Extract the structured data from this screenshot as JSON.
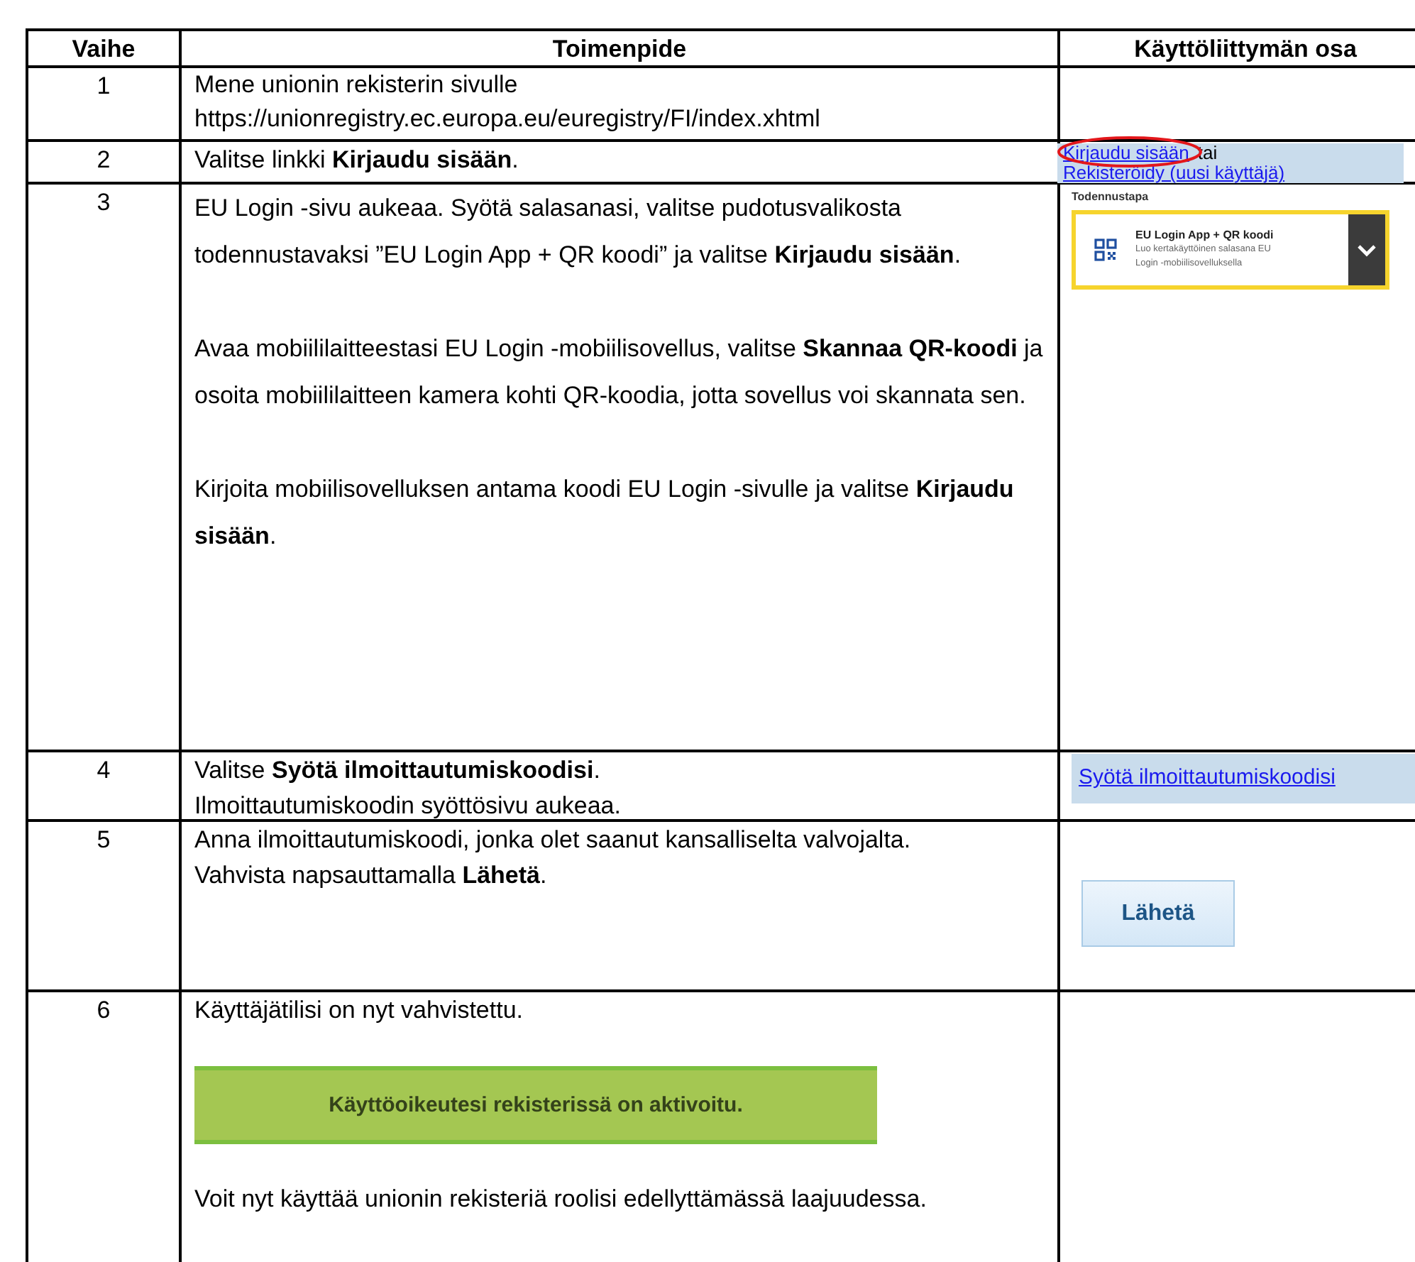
{
  "table": {
    "columns": [
      "Vaihe",
      "Toimenpide",
      "Käyttöliittymän osa"
    ],
    "rows": [
      {
        "step": "1",
        "content": [
          {
            "kind": "text",
            "lines": [
              "Mene unionin rekisterin sivulle https://unionregistry.ec.europa.eu/euregistry/FI/index.xhtml"
            ]
          }
        ]
      },
      {
        "step": "2",
        "content": [
          {
            "kind": "text",
            "lines": [
              "Valitse linkki **Kirjaudu sisään**."
            ]
          }
        ],
        "ui": {
          "kind": "login_links",
          "first_link": "Kirjaudu sisään",
          "joiner": "tai",
          "second_link": "Rekisteröidy (uusi käyttäjä)",
          "circled": true
        }
      },
      {
        "step": "3",
        "content": [
          {
            "kind": "text",
            "lines": [
              "EU Login -sivu aukeaa. Syötä salasanasi, valitse pudotusvalikosta todennustavaksi ”EU Login App + QR koodi” ja valitse **Kirjaudu sisään**."
            ]
          },
          {
            "kind": "text",
            "lines": [
              "Avaa mobiililaitteestasi EU Login -mobiilisovellus, valitse **Skannaa QR-koodi** ja osoita mobiililaitteen kamera kohti QR-koodia, jotta sovellus voi skannata sen."
            ]
          },
          {
            "kind": "text",
            "lines": [
              "Kirjoita mobiilisovelluksen antama koodi EU Login -sivulle ja valitse **Kirjaudu sisään**."
            ]
          }
        ],
        "ui": {
          "kind": "auth_select",
          "label": "Todennustapa",
          "title": "EU Login App + QR koodi",
          "subtitle": "Luo kertakäyttöinen salasana EU Login -mobiilisovelluksella"
        }
      },
      {
        "step": "4",
        "content": [
          {
            "kind": "text",
            "lines": [
              "Valitse **Syötä ilmoittautumiskoodisi**.",
              "Ilmoittautumiskoodin syöttösivu aukeaa."
            ]
          }
        ],
        "ui": {
          "kind": "link",
          "text": "Syötä ilmoittautumiskoodisi"
        }
      },
      {
        "step": "5",
        "content": [
          {
            "kind": "text",
            "lines": [
              "Anna ilmoittautumiskoodi, jonka olet saanut kansalliselta valvojalta.",
              "Vahvista napsauttamalla **Lähetä**."
            ]
          }
        ],
        "ui": {
          "kind": "button",
          "text": "Lähetä"
        }
      },
      {
        "step": "6",
        "content": [
          {
            "kind": "text",
            "lines": [
              "Käyttäjätilisi on nyt vahvistettu."
            ]
          },
          {
            "kind": "banner",
            "text": "Käyttöoikeutesi rekisterissä on aktivoitu."
          },
          {
            "kind": "text",
            "lines": [
              "Voit nyt käyttää unionin rekisteriä roolisi edellyttämässä laajuudessa."
            ]
          }
        ]
      }
    ]
  }
}
